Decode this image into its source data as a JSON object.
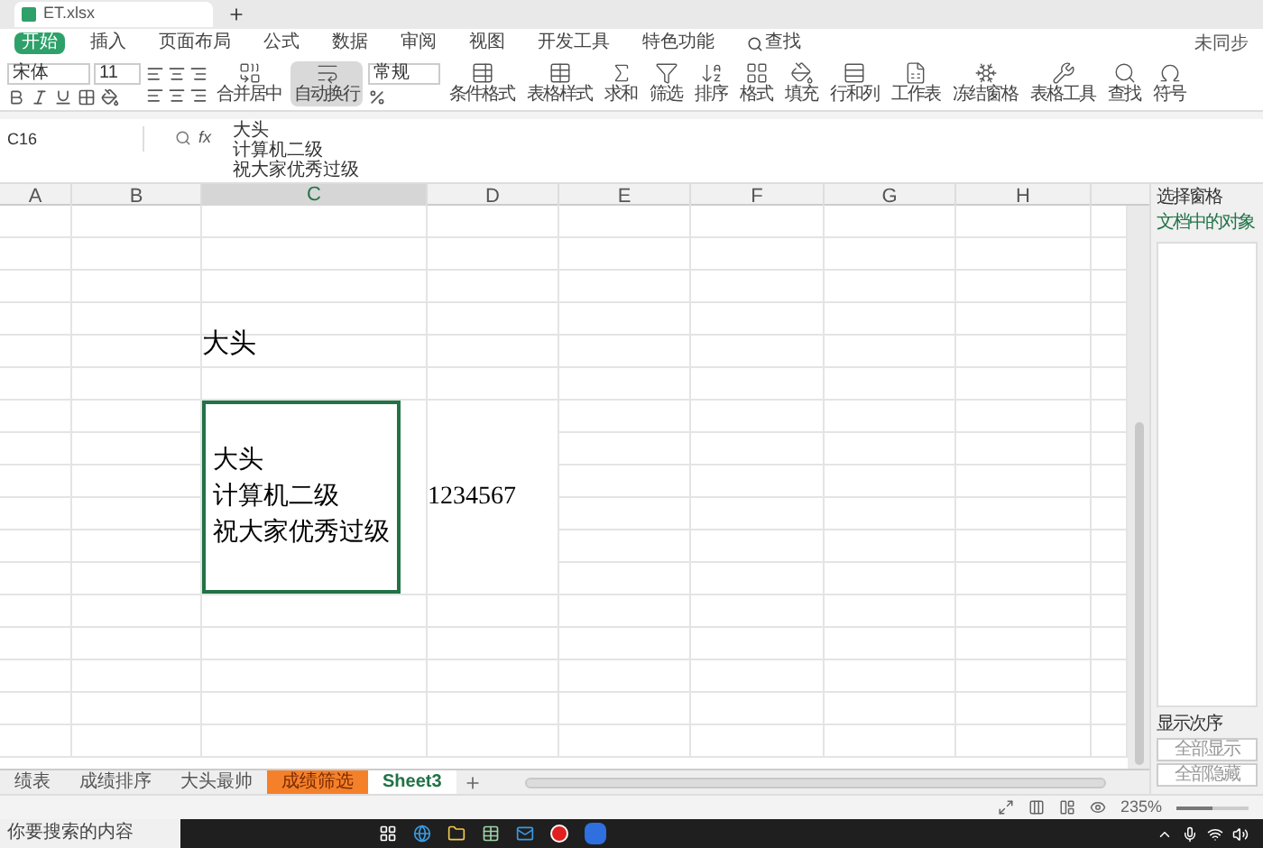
{
  "window": {
    "file_tab": "ET.xlsx",
    "sync": "未同步"
  },
  "menu": [
    {
      "label": "开始",
      "selected": true
    },
    {
      "label": "插入",
      "selected": false
    },
    {
      "label": "页面布局",
      "selected": false
    },
    {
      "label": "公式",
      "selected": false
    },
    {
      "label": "数据",
      "selected": false
    },
    {
      "label": "审阅",
      "selected": false
    },
    {
      "label": "视图",
      "selected": false
    },
    {
      "label": "开发工具",
      "selected": false
    },
    {
      "label": "特色功能",
      "selected": false
    },
    {
      "label": "查找",
      "selected": false,
      "kind": "search"
    }
  ],
  "ribbon": {
    "font": "宋体",
    "size": "11",
    "number_format": "常规",
    "buttons": [
      {
        "label": "合并居中",
        "kind": "merge",
        "on": false
      },
      {
        "label": "自动换行",
        "kind": "wrap",
        "on": true
      },
      {
        "label": "条件格式",
        "kind": "conditional",
        "on": false
      },
      {
        "label": "表格样式",
        "kind": "style",
        "on": false
      },
      {
        "label": "求和",
        "kind": "sum",
        "on": false
      },
      {
        "label": "筛选",
        "kind": "filter",
        "on": false
      },
      {
        "label": "排序",
        "kind": "sort",
        "on": false
      },
      {
        "label": "格式",
        "kind": "format",
        "on": false
      },
      {
        "label": "填充",
        "kind": "fill",
        "on": false
      },
      {
        "label": "行和列",
        "kind": "rowcol",
        "on": false
      },
      {
        "label": "工作表",
        "kind": "sheet",
        "on": false
      },
      {
        "label": "冻结窗格",
        "kind": "freeze",
        "on": false
      },
      {
        "label": "表格工具",
        "kind": "tools",
        "on": false
      },
      {
        "label": "查找",
        "kind": "find",
        "on": false
      },
      {
        "label": "符号",
        "kind": "symbol",
        "on": false
      }
    ]
  },
  "formula_bar": {
    "name_box": "C16",
    "fx_label": "fx",
    "lines": [
      "大头",
      "计算机二级",
      "祝大家优秀过级"
    ]
  },
  "columns": [
    {
      "label": "A",
      "selected": false
    },
    {
      "label": "B",
      "selected": false
    },
    {
      "label": "C",
      "selected": true
    },
    {
      "label": "D",
      "selected": false
    },
    {
      "label": "E",
      "selected": false
    },
    {
      "label": "F",
      "selected": false
    },
    {
      "label": "G",
      "selected": false
    },
    {
      "label": "H",
      "selected": false
    }
  ],
  "cells": [
    {
      "kind": "heading",
      "lines": [
        "大头"
      ],
      "selected": false
    },
    {
      "kind": "multiline",
      "lines": [
        "大头",
        "计算机二级",
        "祝大家优秀过级"
      ],
      "selected": true
    },
    {
      "kind": "number",
      "lines": [
        "1234567"
      ],
      "selected": false
    }
  ],
  "selection_pane": {
    "title": "选择窗格",
    "subtitle": "文档中的对象",
    "order_label": "显示次序",
    "buttons": [
      "全部显示",
      "全部隐藏"
    ]
  },
  "sheets": [
    {
      "label": "绩表",
      "selected": false
    },
    {
      "label": "成绩排序",
      "selected": false
    },
    {
      "label": "大头最帅",
      "selected": false
    },
    {
      "label": "成绩筛选",
      "selected": false,
      "color": "#f5802a"
    },
    {
      "label": "Sheet3",
      "selected": true
    }
  ],
  "status_bar": {
    "zoom": "235%",
    "slider": {
      "level": 0.5
    }
  },
  "taskbar": {
    "search": "你要搜索的内容"
  }
}
